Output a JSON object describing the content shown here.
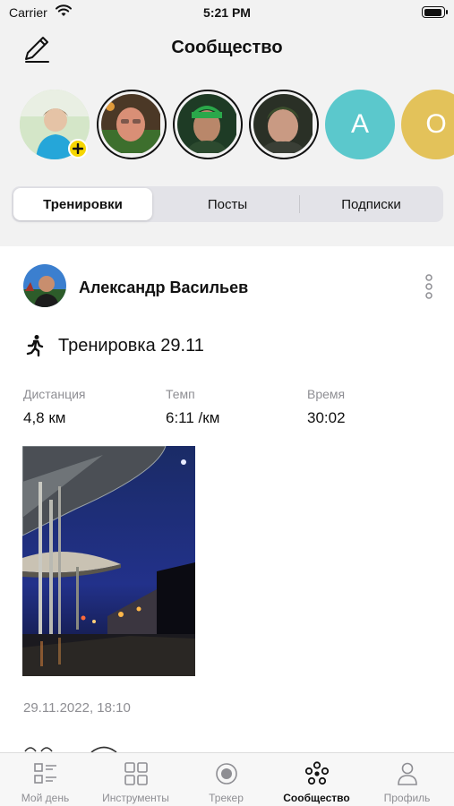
{
  "status_bar": {
    "carrier": "Carrier",
    "time": "5:21 PM"
  },
  "header": {
    "title": "Сообщество",
    "edit_icon": "pencil-icon"
  },
  "stories": [
    {
      "kind": "photo",
      "add_badge": true,
      "colors": [
        "#cfe3c4",
        "#e8c9b0",
        "#25a6d9"
      ]
    },
    {
      "kind": "photo",
      "ring": true,
      "colors": [
        "#5a4030",
        "#d98f76",
        "#3d6f2d"
      ]
    },
    {
      "kind": "photo",
      "ring": true,
      "colors": [
        "#1e3b25",
        "#b9876a",
        "#2aa84a"
      ]
    },
    {
      "kind": "photo",
      "ring": true,
      "colors": [
        "#2a3026",
        "#c99a83",
        "#3b4d2c"
      ]
    },
    {
      "kind": "letter",
      "letter": "A",
      "color": "#5bc8cc"
    },
    {
      "kind": "letter",
      "letter": "O",
      "color": "#e3c25a"
    }
  ],
  "tabs": {
    "workouts": "Тренировки",
    "posts": "Посты",
    "subscriptions": "Подписки",
    "active": "workouts"
  },
  "post": {
    "author": "Александр Васильев",
    "activity_icon": "running-man-icon",
    "title": "Тренировка 29.11",
    "stats": [
      {
        "label": "Дистанция",
        "value": "4,8 км"
      },
      {
        "label": "Темп",
        "value": "6:11 /км"
      },
      {
        "label": "Время",
        "value": "30:02"
      }
    ],
    "date": "29.11.2022, 18:10"
  },
  "bottom_nav": [
    {
      "label": "Мой день",
      "icon": "list-icon"
    },
    {
      "label": "Инструменты",
      "icon": "grid-icon"
    },
    {
      "label": "Трекер",
      "icon": "record-icon"
    },
    {
      "label": "Сообщество",
      "icon": "community-icon",
      "active": true
    },
    {
      "label": "Профиль",
      "icon": "person-icon"
    }
  ]
}
